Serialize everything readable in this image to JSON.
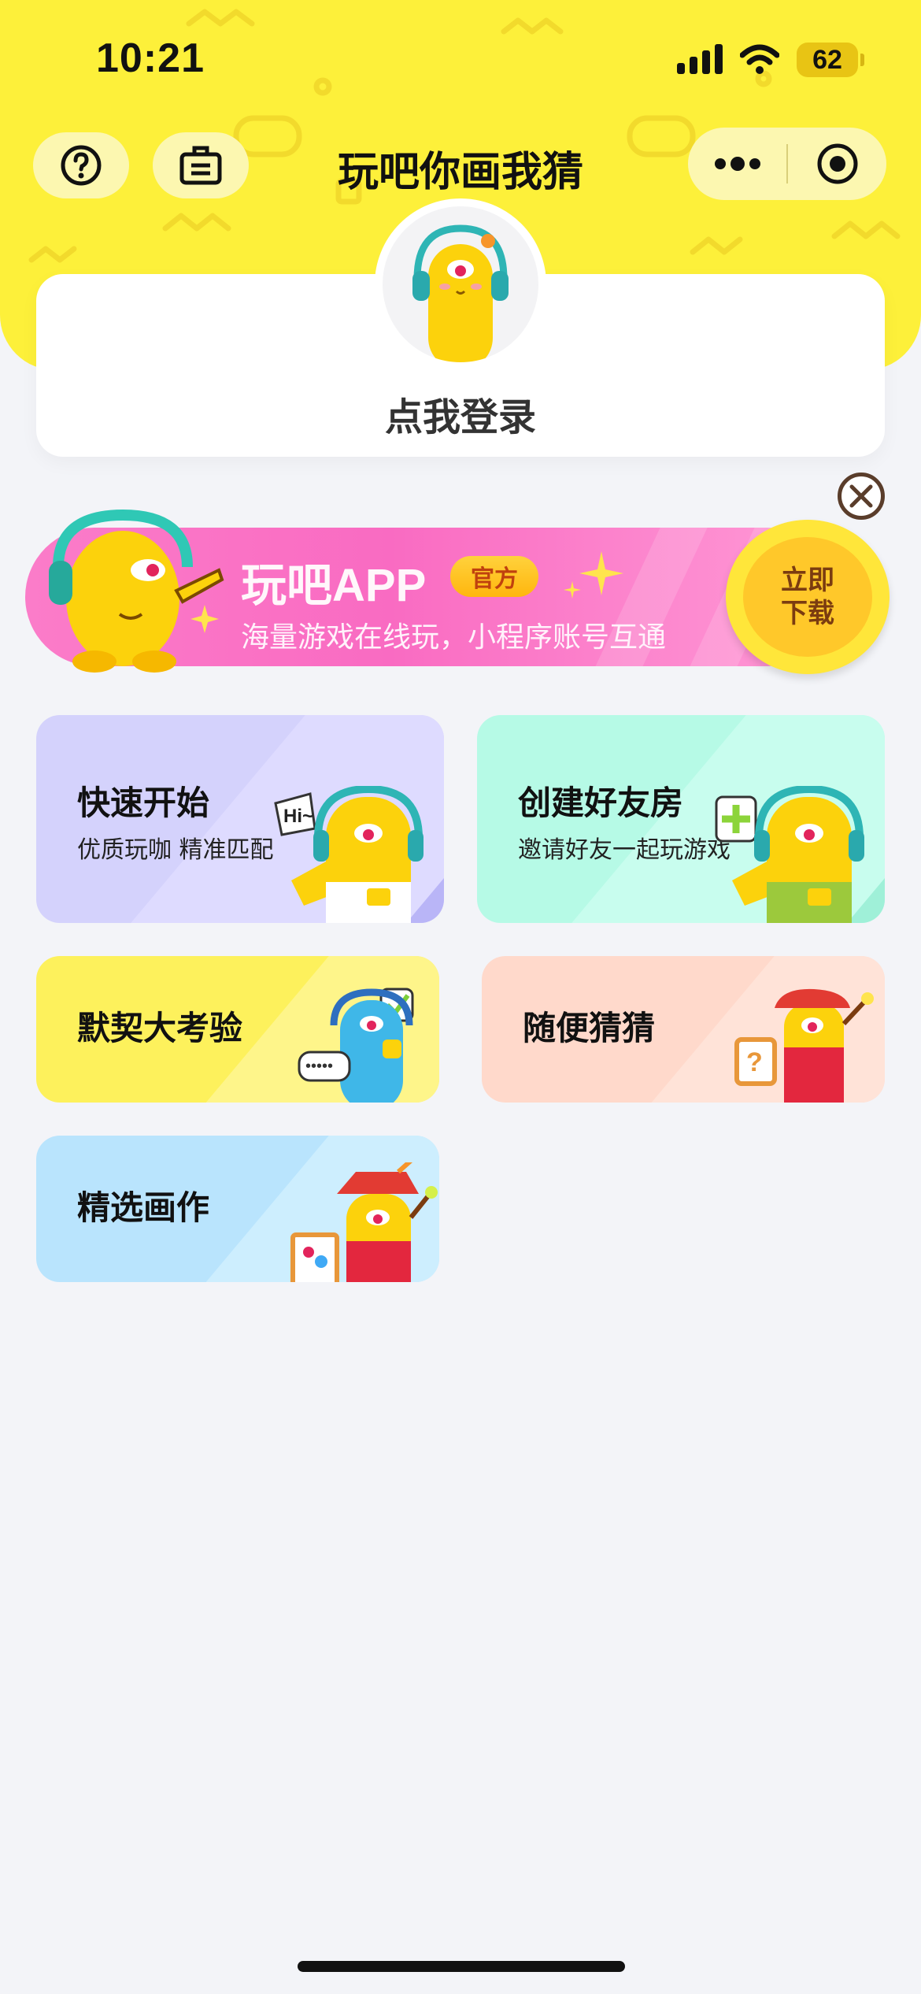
{
  "status_bar": {
    "time": "10:21",
    "battery": "62"
  },
  "nav": {
    "title": "玩吧你画我猜",
    "icons": [
      "help-circle-icon",
      "clipboard-icon",
      "more-dots-icon",
      "record-target-icon"
    ]
  },
  "login": {
    "label": "点我登录"
  },
  "banner": {
    "title": "玩吧APP",
    "badge": "官方",
    "subtitle": "海量游戏在线玩，小程序账号互通",
    "button_line1": "立即",
    "button_line2": "下载"
  },
  "modes": {
    "quick_start": {
      "title": "快速开始",
      "subtitle": "优质玩咖 精准匹配",
      "bubble": "Hi~"
    },
    "friend_room": {
      "title": "创建好友房",
      "subtitle": "邀请好友一起玩游戏"
    },
    "tacit_test": {
      "title": "默契大考验"
    },
    "random_guess": {
      "title": "随便猜猜"
    },
    "featured_art": {
      "title": "精选画作"
    }
  },
  "colors": {
    "header_yellow": "#fdf03a",
    "banner_pink": "#fb7cc9",
    "quick_start_bg": "#d4d2fc",
    "friend_room_bg": "#b6fae6",
    "tacit_test_bg": "#fdf15c",
    "random_guess_bg": "#ffd9cb",
    "featured_art_bg": "#b9e4fd"
  }
}
